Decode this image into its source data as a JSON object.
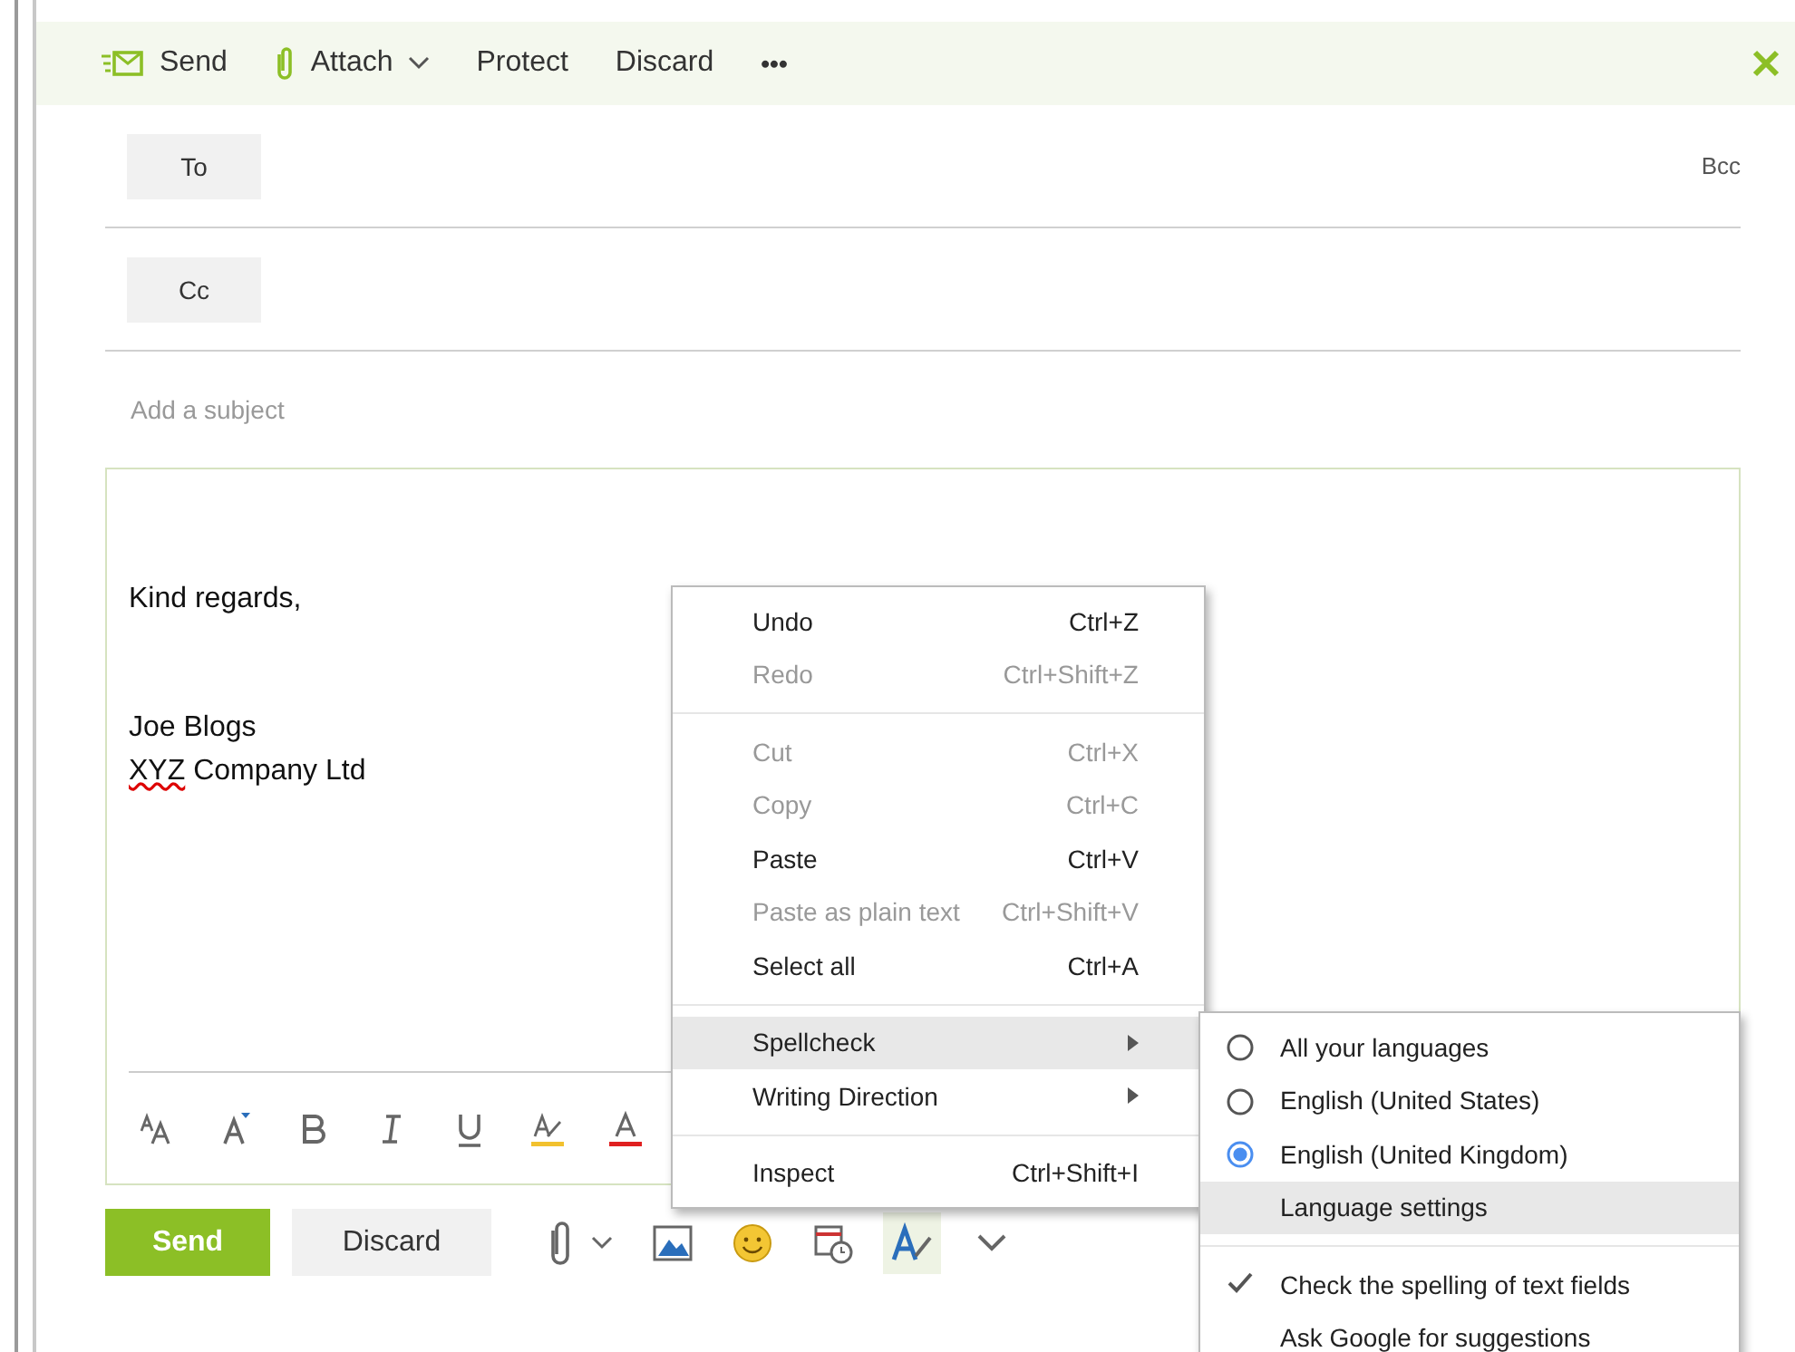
{
  "toolbar": {
    "actions": [
      {
        "kind": "send",
        "label": "Send"
      },
      {
        "kind": "attach",
        "label": "Attach"
      },
      {
        "kind": "plain",
        "label": "Protect"
      },
      {
        "kind": "plain",
        "label": "Discard"
      },
      {
        "kind": "more",
        "label": "•••"
      }
    ]
  },
  "recipients": [
    {
      "label": "To",
      "extra": "Bcc"
    },
    {
      "label": "Cc"
    }
  ],
  "subject": {
    "placeholder": "Add a subject"
  },
  "body": {
    "lines": [
      {
        "segments": [
          {
            "text": "Kind regards,",
            "misspelled": false
          }
        ]
      },
      {
        "segments": [
          {
            "text": "Joe Blogs",
            "misspelled": false
          }
        ]
      },
      {
        "segments": [
          {
            "text": "XYZ",
            "misspelled": true
          },
          {
            "text": " Company Ltd",
            "misspelled": false
          }
        ]
      }
    ]
  },
  "format_tools": [
    {
      "kind": "font-size"
    },
    {
      "kind": "grow-font"
    },
    {
      "kind": "bold"
    },
    {
      "kind": "italic"
    },
    {
      "kind": "underline"
    },
    {
      "kind": "highlight"
    },
    {
      "kind": "font-color"
    }
  ],
  "footer": {
    "send": "Send",
    "discard": "Discard",
    "tools": [
      {
        "kind": "attach",
        "selected": false
      },
      {
        "kind": "image",
        "selected": false
      },
      {
        "kind": "emoji",
        "selected": false
      },
      {
        "kind": "calendar",
        "selected": false
      },
      {
        "kind": "spelling",
        "selected": true
      },
      {
        "kind": "more",
        "selected": false
      }
    ]
  },
  "context_menu": {
    "items": [
      {
        "kind": "item",
        "label": "Undo",
        "shortcut": "Ctrl+Z",
        "disabled": false,
        "selected": false,
        "submenu": false
      },
      {
        "kind": "item",
        "label": "Redo",
        "shortcut": "Ctrl+Shift+Z",
        "disabled": true,
        "selected": false,
        "submenu": false
      },
      {
        "kind": "separator"
      },
      {
        "kind": "item",
        "label": "Cut",
        "shortcut": "Ctrl+X",
        "disabled": true,
        "selected": false,
        "submenu": false
      },
      {
        "kind": "item",
        "label": "Copy",
        "shortcut": "Ctrl+C",
        "disabled": true,
        "selected": false,
        "submenu": false
      },
      {
        "kind": "item",
        "label": "Paste",
        "shortcut": "Ctrl+V",
        "disabled": false,
        "selected": false,
        "submenu": false
      },
      {
        "kind": "item",
        "label": "Paste as plain text",
        "shortcut": "Ctrl+Shift+V",
        "disabled": true,
        "selected": false,
        "submenu": false
      },
      {
        "kind": "item",
        "label": "Select all",
        "shortcut": "Ctrl+A",
        "disabled": false,
        "selected": false,
        "submenu": false
      },
      {
        "kind": "separator"
      },
      {
        "kind": "item",
        "label": "Spellcheck",
        "disabled": false,
        "selected": true,
        "submenu": true
      },
      {
        "kind": "item",
        "label": "Writing Direction",
        "disabled": false,
        "selected": false,
        "submenu": true
      },
      {
        "kind": "separator"
      },
      {
        "kind": "item",
        "label": "Inspect",
        "shortcut": "Ctrl+Shift+I",
        "disabled": false,
        "selected": false,
        "submenu": false
      }
    ]
  },
  "spellcheck_menu": {
    "items": [
      {
        "kind": "radio",
        "label": "All your languages",
        "checked": false,
        "selected": false
      },
      {
        "kind": "radio",
        "label": "English (United States)",
        "checked": false,
        "selected": false
      },
      {
        "kind": "radio",
        "label": "English (United Kingdom)",
        "checked": true,
        "selected": false
      },
      {
        "kind": "item",
        "label": "Language settings",
        "selected": true
      },
      {
        "kind": "separator"
      },
      {
        "kind": "check",
        "label": "Check the spelling of text fields",
        "checked": true,
        "selected": false
      },
      {
        "kind": "check",
        "label": "Ask Google for suggestions",
        "checked": false,
        "selected": false
      }
    ]
  }
}
